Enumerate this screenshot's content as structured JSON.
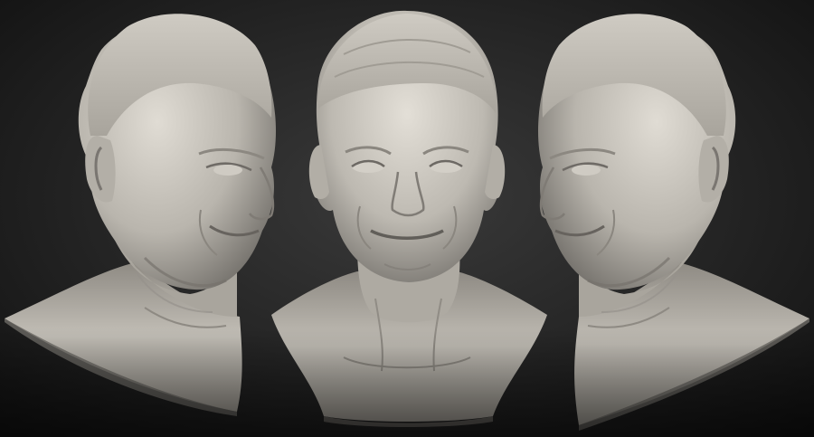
{
  "scene": {
    "subject": "sculpt-turnaround",
    "views": [
      {
        "view": "three-quarter-right"
      },
      {
        "view": "front"
      },
      {
        "view": "three-quarter-left"
      }
    ]
  },
  "colors": {
    "background_top": "#3a3a3a",
    "background_bottom": "#111111",
    "clay_light": "#d9d5cd",
    "clay_mid": "#a9a59d",
    "clay_shadow": "#5f5c57"
  }
}
